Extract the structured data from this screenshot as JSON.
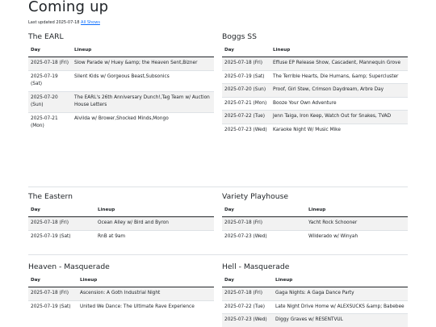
{
  "page": {
    "title": "Coming up",
    "updated_prefix": "Last updated 2025-07-18",
    "all_shows_link": "All Shows"
  },
  "headers": {
    "day": "Day",
    "lineup": "Lineup"
  },
  "venues": {
    "earl": {
      "name": "The EARL",
      "rows": [
        {
          "day": "2025-07-18 (Fri)",
          "lineup": "Slow Parade w/ Huey &amp; the Heaven Sent,Bizner"
        },
        {
          "day": "2025-07-19 (Sat)",
          "lineup": "Silent Kids w/ Gorgeous Beast,Subsonics"
        },
        {
          "day": "2025-07-20 (Sun)",
          "lineup": "The EARL's 26th Anniversary Dunch!,Tag Team w/ Auction House Letters"
        },
        {
          "day": "2025-07-21 (Mon)",
          "lineup": "Alvilda w/ Brower,Shocked Minds,Mongo"
        }
      ]
    },
    "boggs": {
      "name": "Boggs SS",
      "rows": [
        {
          "day": "2025-07-18 (Fri)",
          "lineup": "Effuse EP Release Show, Cascadent, Mannequin Grove"
        },
        {
          "day": "2025-07-19 (Sat)",
          "lineup": "The Terrible Hearts, Die Humans, &amp; Supercluster"
        },
        {
          "day": "2025-07-20 (Sun)",
          "lineup": "Proof, Girl Stew, Crimson Daydream, Arbre Day"
        },
        {
          "day": "2025-07-21 (Mon)",
          "lineup": "Booze Your Own Adventure"
        },
        {
          "day": "2025-07-22 (Tue)",
          "lineup": "Jenn Taiga, Iron Keep, Watch Out for Snakes, TVAD"
        },
        {
          "day": "2025-07-23 (Wed)",
          "lineup": "Karaoke Night W/ Music Mike"
        }
      ]
    },
    "eastern": {
      "name": "The Eastern",
      "rows": [
        {
          "day": "2025-07-18 (Fri)",
          "lineup": "Ocean Alley w/ Bird and Byron"
        },
        {
          "day": "2025-07-19 (Sat)",
          "lineup": "RnB at 9am"
        }
      ]
    },
    "variety": {
      "name": "Variety Playhouse",
      "rows": [
        {
          "day": "2025-07-18 (Fri)",
          "lineup": "Yacht Rock Schooner"
        },
        {
          "day": "2025-07-23 (Wed)",
          "lineup": "Wilderado w/ Winyah"
        }
      ]
    },
    "heaven": {
      "name": "Heaven - Masquerade",
      "rows": [
        {
          "day": "2025-07-18 (Fri)",
          "lineup": "Ascension: A Goth Industrial Night"
        },
        {
          "day": "2025-07-19 (Sat)",
          "lineup": "United We Dance: The Ultimate Rave Experience"
        }
      ]
    },
    "hell": {
      "name": "Hell - Masquerade",
      "rows": [
        {
          "day": "2025-07-18 (Fri)",
          "lineup": "Gaga Nights: A Gaga Dance Party"
        },
        {
          "day": "2025-07-22 (Tue)",
          "lineup": "Late Night Drive Home w/ ALEXSUCKS &amp; Babebee"
        },
        {
          "day": "2025-07-23 (Wed)",
          "lineup": "Diggy Graves w/ RESENTVUL"
        }
      ]
    }
  }
}
